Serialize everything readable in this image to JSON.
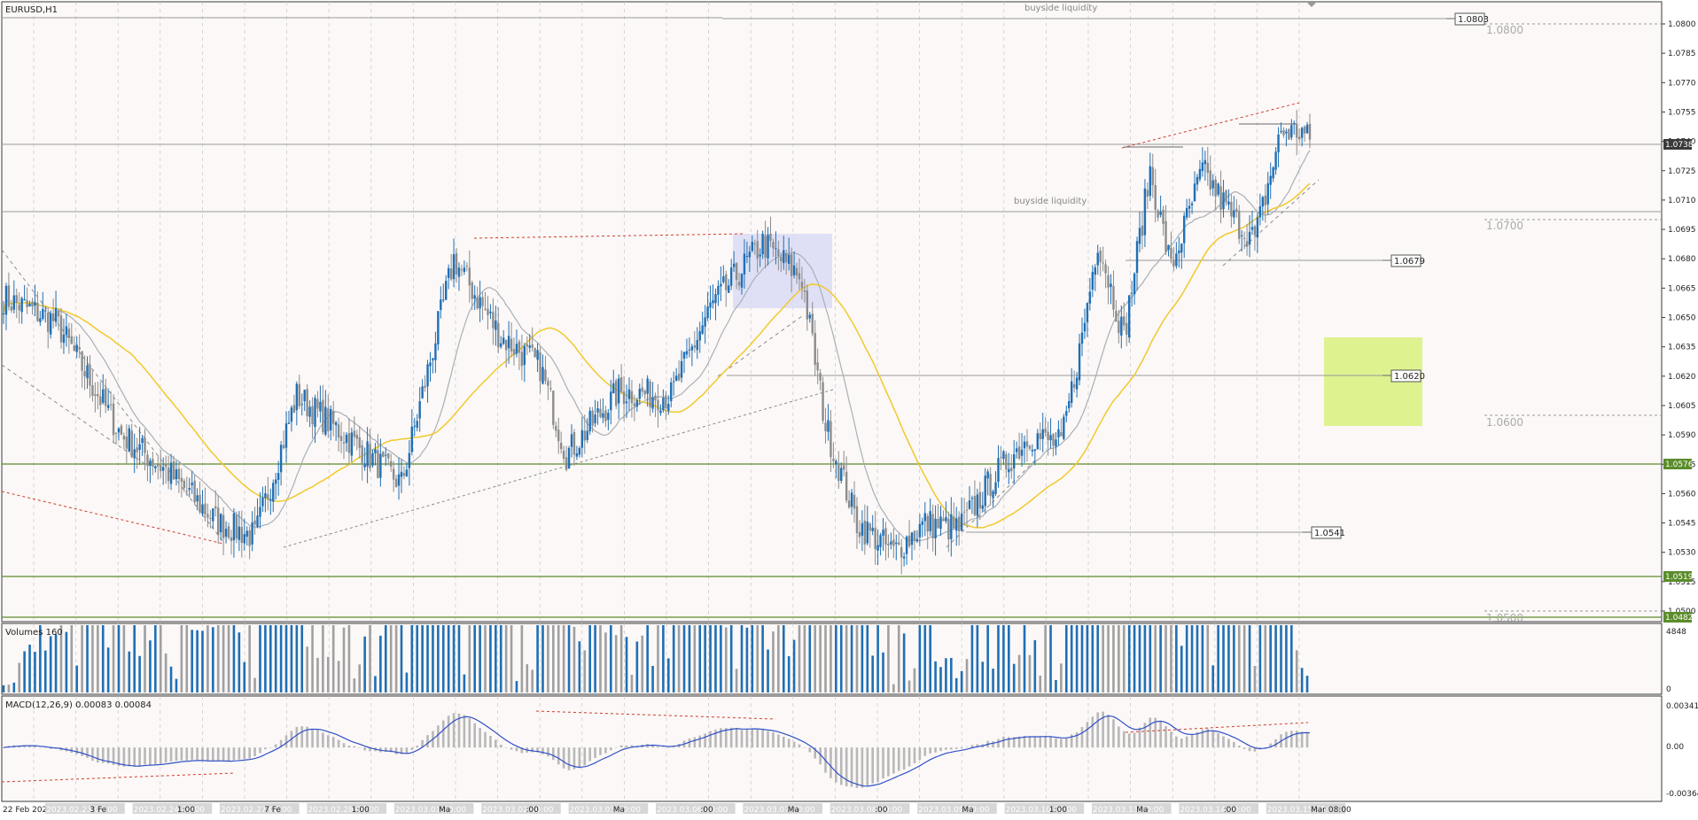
{
  "symbol_label": "EURUSD,H1",
  "colors": {
    "background": "#fbf8f7",
    "frame": "#3a3a3a",
    "grid": "#c8c8c8",
    "bull_candle": "#1f6fb5",
    "bear_candle": "#8c8c8c",
    "ma_fast": "#a8b0b8",
    "ma_slow": "#f2c92b",
    "green_level": "#5b8c2a",
    "red_trend": "#d23c2c",
    "gray_trend": "#8a8a8a",
    "blue_zone": "#d9dcf4",
    "green_zone": "#d8f27c",
    "macd_signal": "#3050c8",
    "macd_hist": "#b8b8b8",
    "volume_up": "#1f6fb5",
    "volume_down": "#a0a0a0"
  },
  "price_axis": {
    "ticks": [
      "1.0800",
      "1.0785",
      "1.0770",
      "1.0755",
      "1.0740",
      "1.0725",
      "1.0710",
      "1.0695",
      "1.0680",
      "1.0665",
      "1.0650",
      "1.0635",
      "1.0620",
      "1.0605",
      "1.0590",
      "1.0575",
      "1.0560",
      "1.0545",
      "1.0530",
      "1.0515",
      "1.0500",
      "1.0485"
    ],
    "tag_current": "1.0738",
    "tag_level_high": "1.0576",
    "tag_level_low": "1.0519",
    "tag_level_bottom": "1.0482"
  },
  "annotations": {
    "buyside_top": "buyside liquidity",
    "buyside_mid": "buyside liquidity",
    "price_label_1": "1.0803",
    "price_label_2": "1.0679",
    "price_label_3": "1.0620",
    "price_label_4": "1.0541",
    "round_1": "1.0800",
    "round_2": "1.0700",
    "round_3": "1.0600",
    "round_4": "1.0500"
  },
  "volume_panel": {
    "label": "Volumes 160",
    "axis_top": "4848",
    "axis_bottom": "0"
  },
  "macd_panel": {
    "label": "MACD(12,26,9) 0.00083 0.00084",
    "axis_top": "0.00341",
    "axis_mid": "0.00",
    "axis_bottom": "-0.00364"
  },
  "time_axis": {
    "labels": [
      "22 Feb 2023",
      "2023.02.23 00:00",
      "3 Fe",
      "2023.02.24 00:00",
      "1:00",
      "2023.02.27 00:00",
      "7 Fe",
      "2023.02.28 00:00",
      "1:00",
      "2023.03.01 00:00",
      "Ma",
      "2023.03.02 00:00",
      ":00",
      "2023.03.03 00:00",
      "Ma",
      "2023.03.06 00:00",
      ":00",
      "2023.03.07 00:00",
      "Ma",
      "2023.03.08 00:00",
      ":00",
      "2023.03.09 00:00",
      "Ma",
      "2023.03.10 00:00",
      "1:00",
      "2023.03.13 00:00",
      "Ma",
      "2023.03.14 00:00",
      ":00",
      "2023.03.15 00:00",
      "Mar 08:00"
    ]
  },
  "chart_data": {
    "type": "candlestick",
    "symbol": "EURUSD",
    "timeframe": "H1",
    "x_range": [
      "2023-02-22",
      "2023-03-15 08:00"
    ],
    "ylim": [
      1.0482,
      1.0815
    ],
    "key_levels": [
      1.0803,
      1.0738,
      1.0679,
      1.062,
      1.0576,
      1.0541,
      1.0519,
      1.0482
    ],
    "price_path_anchors": [
      [
        0,
        1.066
      ],
      [
        20,
        1.0648
      ],
      [
        45,
        1.059
      ],
      [
        62,
        1.0572
      ],
      [
        82,
        1.0545
      ],
      [
        96,
        1.0538
      ],
      [
        112,
        1.061
      ],
      [
        132,
        1.0588
      ],
      [
        152,
        1.0565
      ],
      [
        172,
        1.068
      ],
      [
        190,
        1.064
      ],
      [
        205,
        1.0625
      ],
      [
        215,
        1.058
      ],
      [
        235,
        1.0612
      ],
      [
        255,
        1.061
      ],
      [
        270,
        1.0655
      ],
      [
        290,
        1.0688
      ],
      [
        305,
        1.067
      ],
      [
        314,
        1.0595
      ],
      [
        326,
        1.0545
      ],
      [
        340,
        1.053
      ],
      [
        352,
        1.0545
      ],
      [
        365,
        1.0542
      ],
      [
        378,
        1.0568
      ],
      [
        392,
        1.059
      ],
      [
        404,
        1.0585
      ],
      [
        412,
        1.064
      ],
      [
        418,
        1.069
      ],
      [
        428,
        1.064
      ],
      [
        438,
        1.0725
      ],
      [
        446,
        1.0675
      ],
      [
        458,
        1.0725
      ],
      [
        470,
        1.07
      ],
      [
        478,
        1.069
      ],
      [
        488,
        1.0745
      ],
      [
        496,
        1.0745
      ],
      [
        500,
        1.0738
      ]
    ],
    "volume_range": [
      0,
      4848
    ],
    "macd_range": [
      -0.00364,
      0.00341
    ]
  }
}
